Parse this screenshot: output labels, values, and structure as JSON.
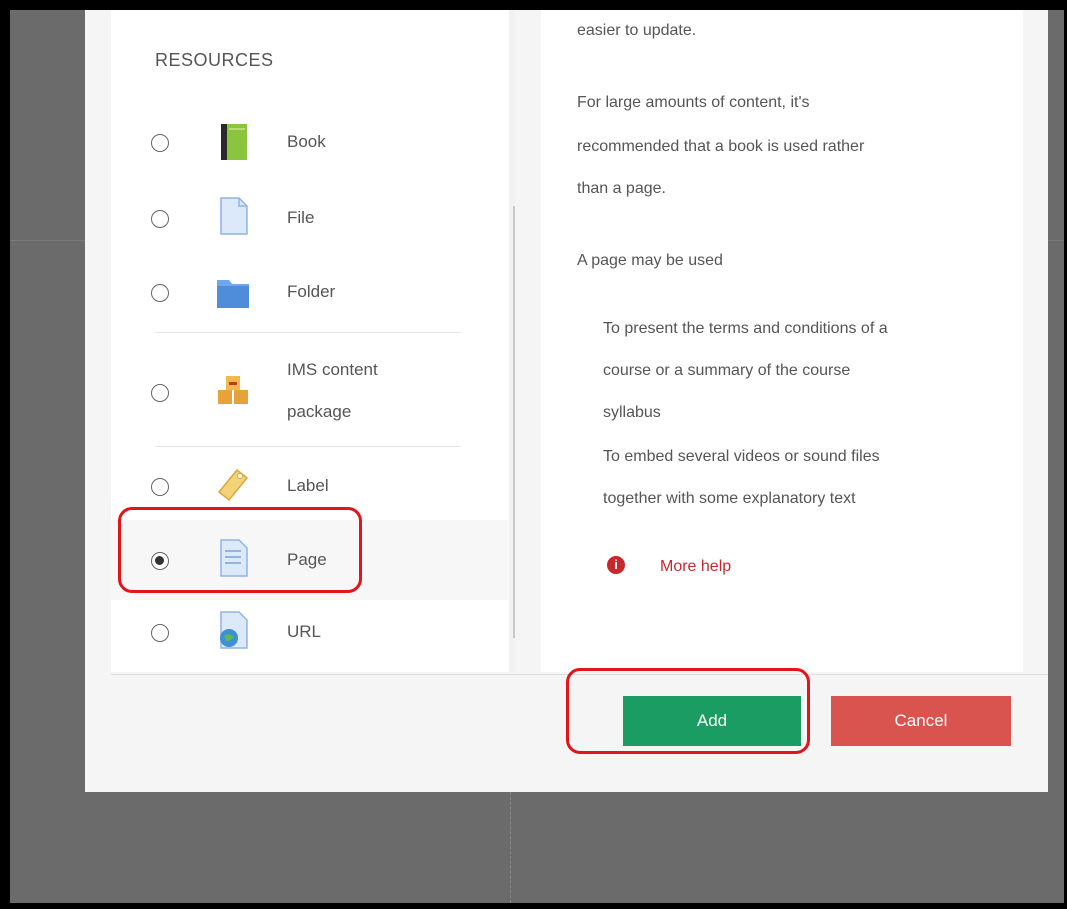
{
  "section_title": "RESOURCES",
  "items": [
    {
      "label": "Book",
      "icon": "book-icon",
      "checked": false
    },
    {
      "label": "File",
      "icon": "file-icon",
      "checked": false
    },
    {
      "label": "Folder",
      "icon": "folder-icon",
      "checked": false
    },
    {
      "label": "IMS content",
      "label2": "package",
      "icon": "ims-package-icon",
      "checked": false
    },
    {
      "label": "Label",
      "icon": "tag-icon",
      "checked": false
    },
    {
      "label": "Page",
      "icon": "page-icon",
      "checked": true
    },
    {
      "label": "URL",
      "icon": "url-icon",
      "checked": false
    }
  ],
  "help": {
    "line0": "easier to update.",
    "p1a": "For large amounts of content, it's",
    "p1b": "recommended that a book is used rather",
    "p1c": "than a page.",
    "p2": "A page may be used",
    "b1a": "To present the terms and conditions of a",
    "b1b": "course or a summary of the course",
    "b1c": "syllabus",
    "b2a": "To embed several videos or sound files",
    "b2b": "together with some explanatory text",
    "more_help": "More help",
    "info_icon_glyph": "i"
  },
  "buttons": {
    "add": "Add",
    "cancel": "Cancel"
  },
  "scroll_down_glyph": "⌄",
  "colors": {
    "add": "#1a9c63",
    "cancel": "#d9534f",
    "highlight": "#e3141a",
    "link": "#c8282c"
  }
}
